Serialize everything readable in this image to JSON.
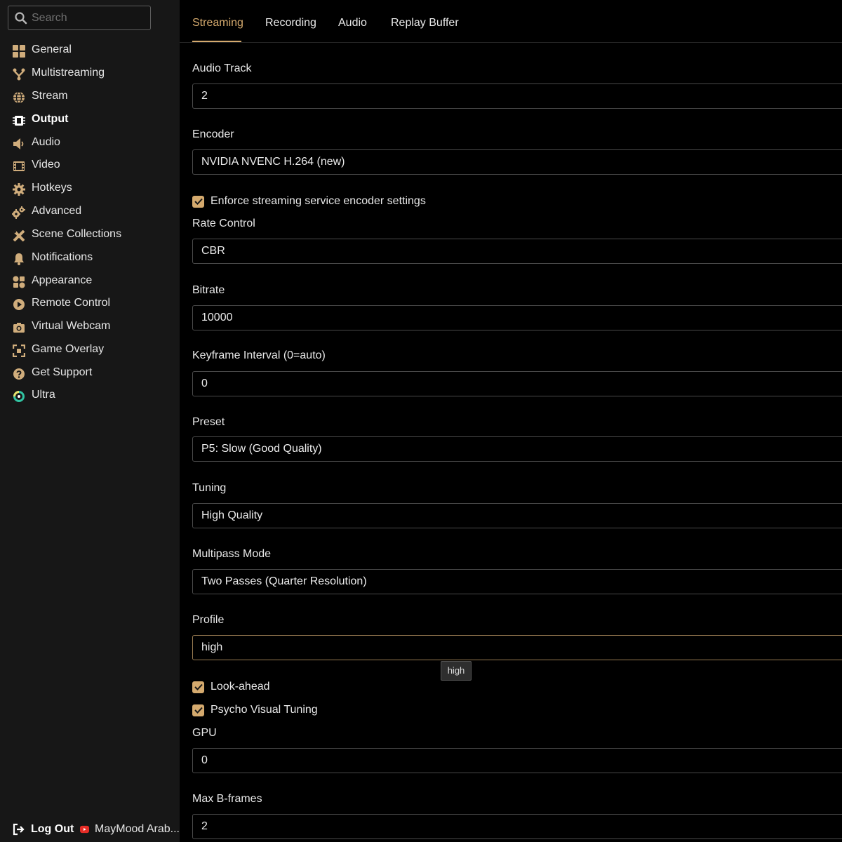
{
  "search": {
    "placeholder": "Search"
  },
  "sidebar": {
    "items": [
      {
        "label": "General",
        "icon": "grid-icon"
      },
      {
        "label": "Multistreaming",
        "icon": "branch-icon"
      },
      {
        "label": "Stream",
        "icon": "globe-icon"
      },
      {
        "label": "Output",
        "icon": "chip-icon",
        "active": true
      },
      {
        "label": "Audio",
        "icon": "speaker-icon"
      },
      {
        "label": "Video",
        "icon": "film-icon"
      },
      {
        "label": "Hotkeys",
        "icon": "gear-icon"
      },
      {
        "label": "Advanced",
        "icon": "gears-icon"
      },
      {
        "label": "Scene Collections",
        "icon": "tools-icon"
      },
      {
        "label": "Notifications",
        "icon": "bell-icon"
      },
      {
        "label": "Appearance",
        "icon": "shapes-icon"
      },
      {
        "label": "Remote Control",
        "icon": "play-circle-icon"
      },
      {
        "label": "Virtual Webcam",
        "icon": "camera-icon"
      },
      {
        "label": "Game Overlay",
        "icon": "expand-icon"
      },
      {
        "label": "Get Support",
        "icon": "question-icon"
      },
      {
        "label": "Ultra",
        "icon": "ultra-ring-icon"
      }
    ],
    "footer": {
      "logout_label": "Log Out",
      "account_label": "MayMood Arab..."
    }
  },
  "tabs": [
    {
      "label": "Streaming",
      "active": true
    },
    {
      "label": "Recording"
    },
    {
      "label": "Audio"
    },
    {
      "label": "Replay Buffer"
    }
  ],
  "settings": {
    "audio_track": {
      "label": "Audio Track",
      "value": "2"
    },
    "encoder": {
      "label": "Encoder",
      "value": "NVIDIA NVENC H.264 (new)"
    },
    "enforce": {
      "label": "Enforce streaming service encoder settings",
      "checked": true
    },
    "rate_control": {
      "label": "Rate Control",
      "value": "CBR"
    },
    "bitrate": {
      "label": "Bitrate",
      "value": "10000"
    },
    "keyframe": {
      "label": "Keyframe Interval (0=auto)",
      "value": "0"
    },
    "preset": {
      "label": "Preset",
      "value": "P5: Slow (Good Quality)"
    },
    "tuning": {
      "label": "Tuning",
      "value": "High Quality"
    },
    "multipass": {
      "label": "Multipass Mode",
      "value": "Two Passes (Quarter Resolution)"
    },
    "profile": {
      "label": "Profile",
      "value": "high"
    },
    "lookahead": {
      "label": "Look-ahead",
      "checked": true
    },
    "psycho": {
      "label": "Psycho Visual Tuning",
      "checked": true
    },
    "gpu": {
      "label": "GPU",
      "value": "0"
    },
    "bframes": {
      "label": "Max B-frames",
      "value": "2"
    }
  },
  "tooltip": {
    "text": "high"
  },
  "colors": {
    "accent": "#d5aa6e",
    "sidebar_bg": "#171717",
    "main_bg": "#000000",
    "icon": "#d0ad7c",
    "youtube": "#e52d27",
    "ultra_green": "#31c3a2"
  }
}
